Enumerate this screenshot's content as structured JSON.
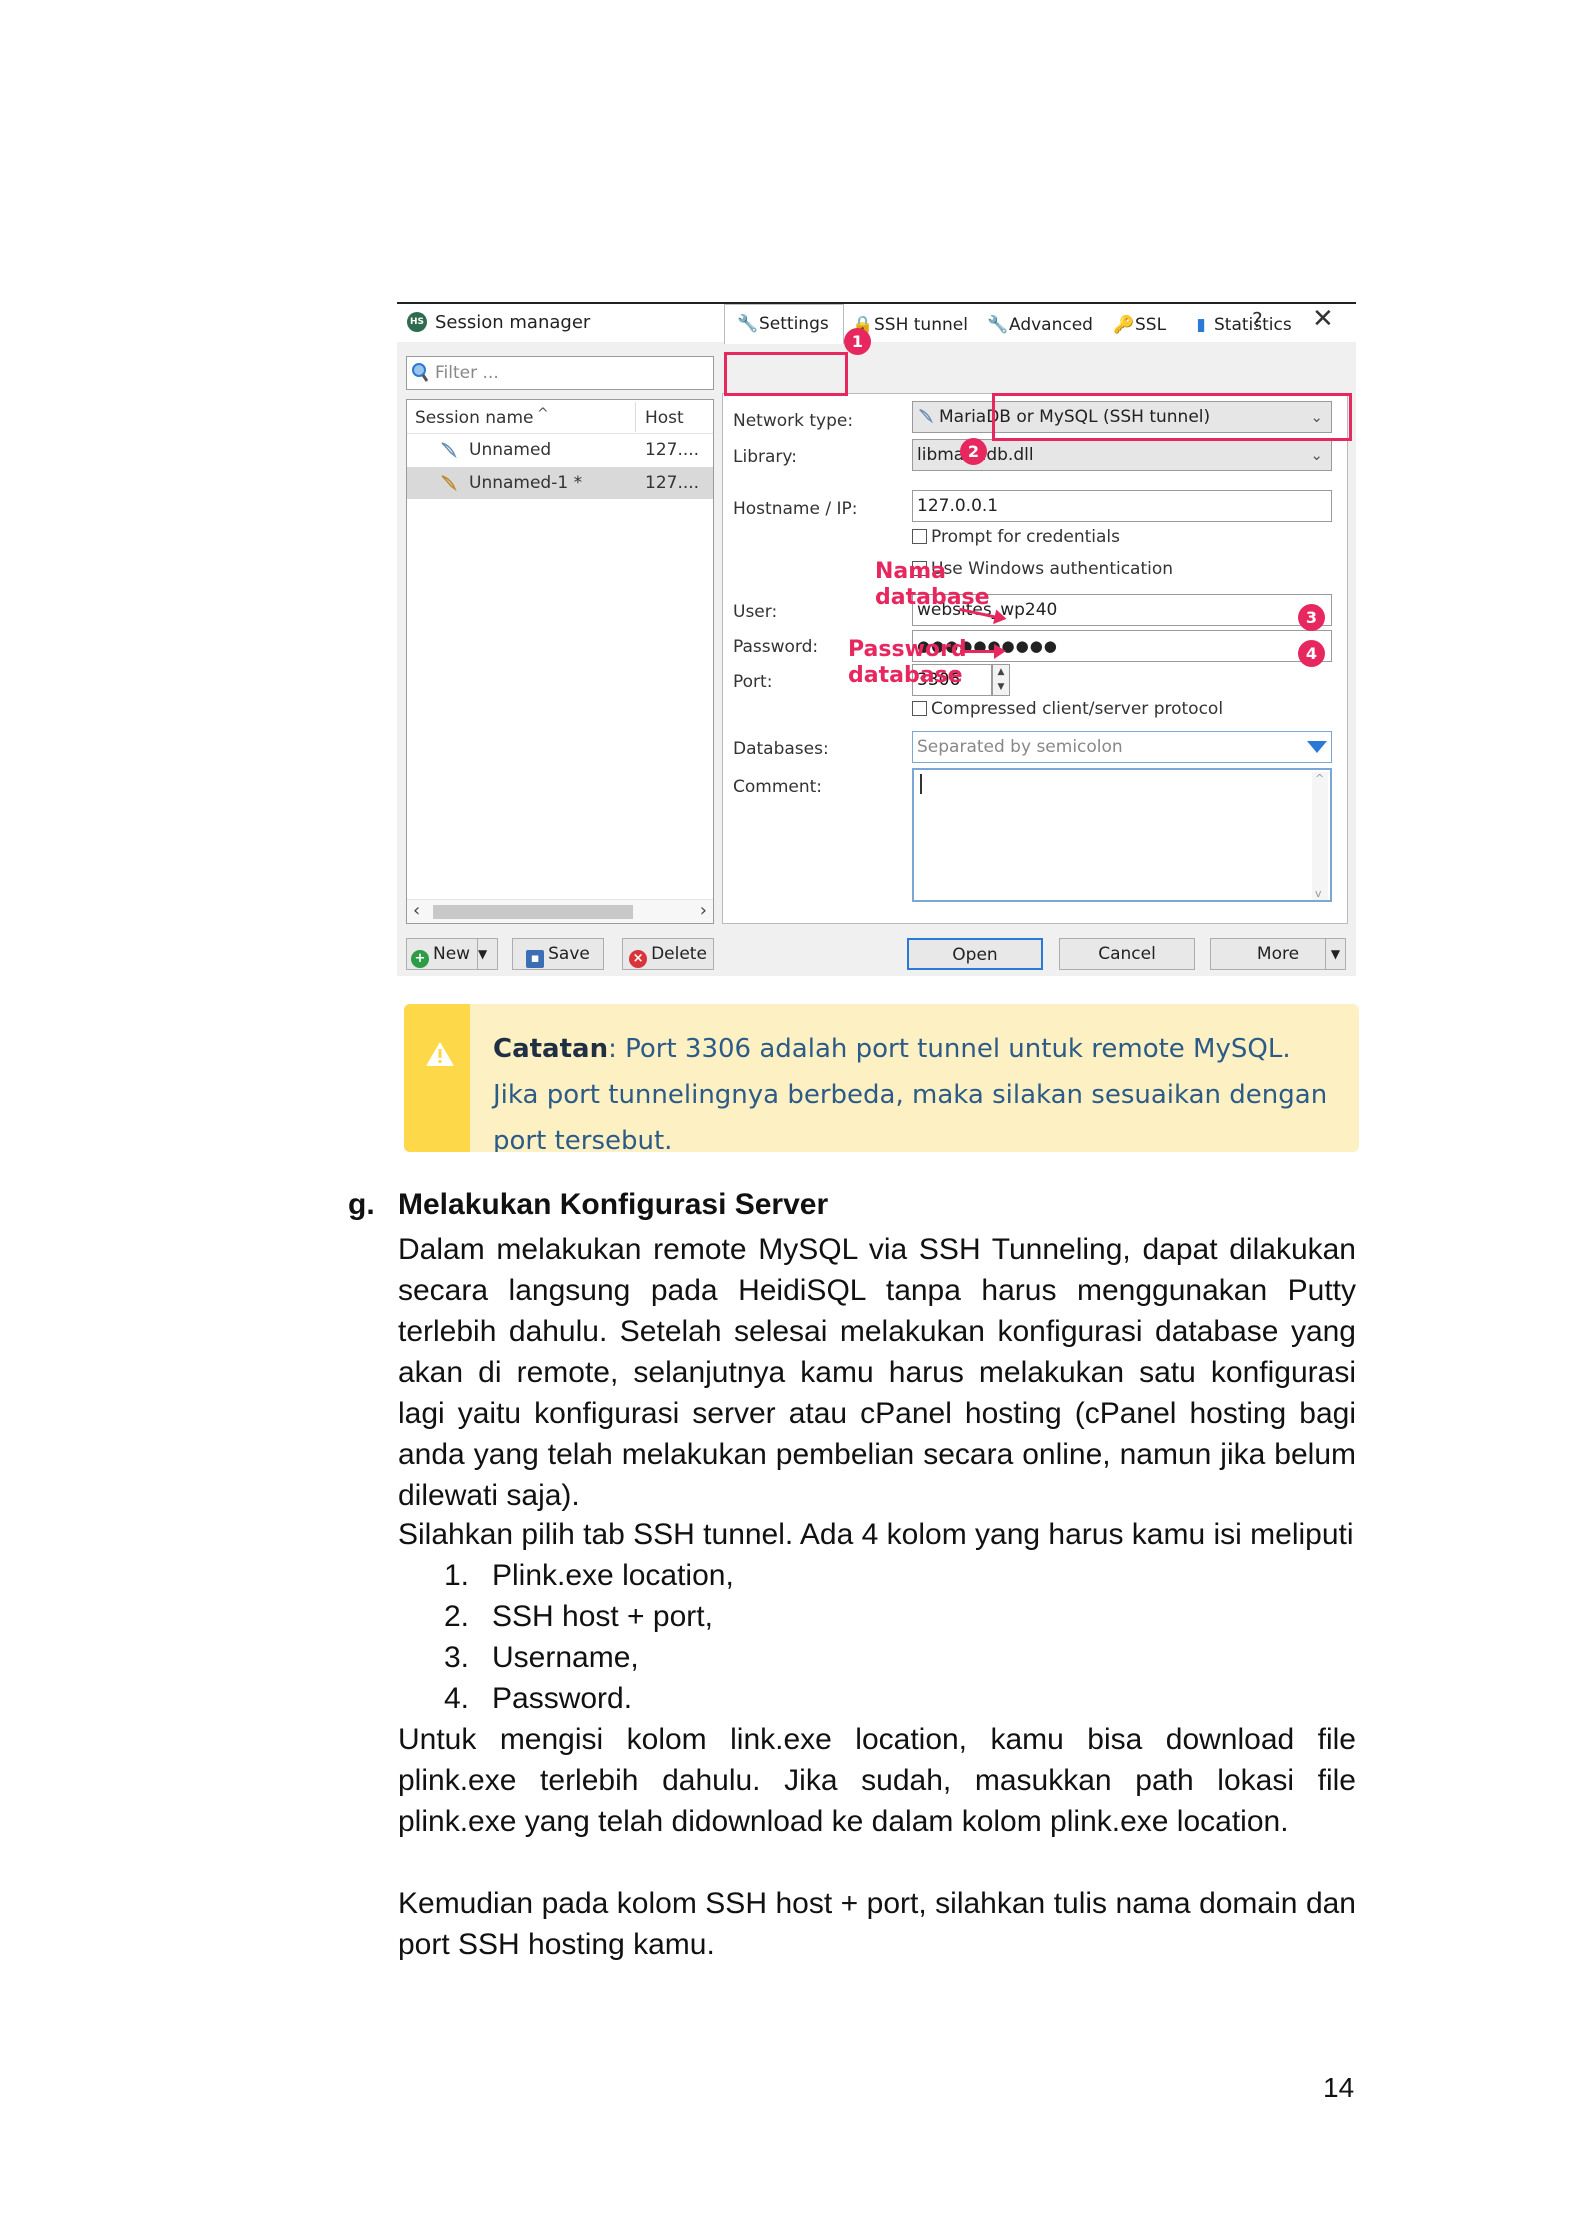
{
  "screenshot": {
    "window_title": "Session manager",
    "help_label": "?",
    "close_label": "✕",
    "filter_placeholder": "Filter ...",
    "session_columns": [
      "Session name",
      "Host"
    ],
    "sessions": [
      {
        "name": "Unnamed",
        "host": "127...."
      },
      {
        "name": "Unnamed-1 *",
        "host": "127...."
      }
    ],
    "tabs": [
      "Settings",
      "SSH tunnel",
      "Advanced",
      "SSL",
      "Statistics"
    ],
    "labels": {
      "network_type": "Network type:",
      "library": "Library:",
      "hostname": "Hostname / IP:",
      "user": "User:",
      "password": "Password:",
      "port": "Port:",
      "databases": "Databases:",
      "comment": "Comment:"
    },
    "values": {
      "network_type": "MariaDB or MySQL (SSH tunnel)",
      "library": "libmariadb.dll",
      "hostname": "127.0.0.1",
      "user": "websites_wp240",
      "password": "●●●●●●●●●●",
      "port": "3306",
      "databases_placeholder": "Separated by semicolon"
    },
    "checkboxes": {
      "prompt": "Prompt for credentials",
      "windows_auth": "Use Windows authentication",
      "compressed": "Compressed client/server protocol"
    },
    "annotations": {
      "nama_db_1": "Nama",
      "nama_db_2": "database",
      "pass_db_1": "Password",
      "pass_db_2": "database",
      "badges": [
        "1",
        "2",
        "3",
        "4"
      ]
    },
    "buttons": {
      "new": "New",
      "save": "Save",
      "delete": "Delete",
      "open": "Open",
      "cancel": "Cancel",
      "more": "More"
    }
  },
  "callout": {
    "label": "Catatan",
    "text": ": Port 3306 adalah port tunnel untuk remote MySQL. Jika port tunnelingnya berbeda, maka silakan sesuaikan dengan port tersebut."
  },
  "section": {
    "letter": "g.",
    "title": "Melakukan Konfigurasi Server",
    "para1": "Dalam melakukan remote MySQL via SSH Tunneling, dapat dilakukan secara langsung pada HeidiSQL tanpa harus menggunakan Putty terlebih dahulu. Setelah selesai melakukan konfigurasi database yang akan di remote, selanjutnya kamu harus melakukan satu konfigurasi lagi yaitu konfigurasi server atau cPanel hosting (cPanel hosting bagi anda yang telah melakukan pembelian secara online, namun jika belum dilewati saja).",
    "para2": "Silahkan pilih tab SSH tunnel. Ada 4 kolom yang harus kamu isi meliputi",
    "list": [
      {
        "n": "1.",
        "text": "Plink.exe location,"
      },
      {
        "n": "2.",
        "text": "SSH host + port,"
      },
      {
        "n": "3.",
        "text": "Username,"
      },
      {
        "n": "4.",
        "text": "Password."
      }
    ],
    "para3": "Untuk mengisi kolom link.exe location, kamu bisa download file plink.exe terlebih dahulu. Jika sudah, masukkan path lokasi file plink.exe yang telah didownload ke dalam kolom plink.exe location.",
    "para4": "Kemudian pada kolom SSH host + port, silahkan tulis nama domain dan port SSH hosting kamu."
  },
  "page_number": "14",
  "colors": {
    "annotation": "#e7285f",
    "callout_bg": "#fdf1c4",
    "callout_bar": "#fdd94a",
    "callout_text": "#2c5b87"
  }
}
